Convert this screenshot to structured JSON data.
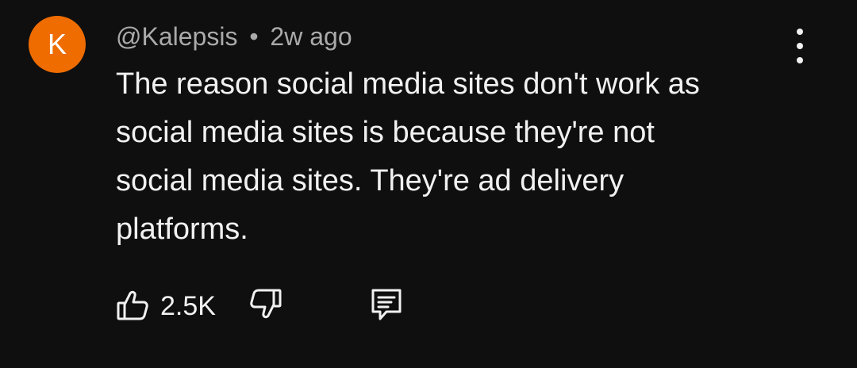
{
  "comment": {
    "avatar_letter": "K",
    "avatar_color": "#ef6c00",
    "author": "@Kalepsis",
    "separator": "•",
    "time_ago": "2w ago",
    "text_lines": [
      "The reason social media sites don't work as",
      "social media sites is because they're not",
      "social media sites. They're ad delivery",
      "platforms."
    ],
    "like_count": "2.5K",
    "icons": {
      "menu": "more-vert-icon",
      "like": "thumbs-up-icon",
      "dislike": "thumbs-down-icon",
      "reply": "reply-comment-icon"
    }
  }
}
